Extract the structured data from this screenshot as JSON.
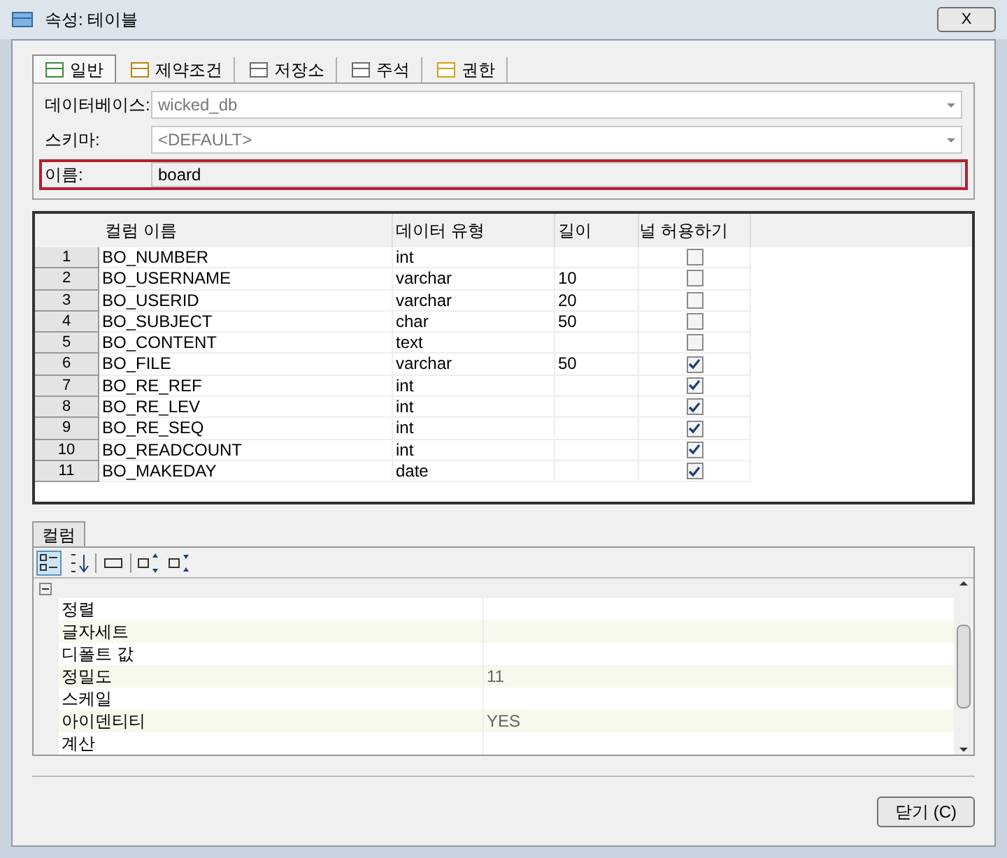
{
  "window": {
    "title": "속성: 테이블",
    "close": "X"
  },
  "tabs": [
    {
      "label": "일반",
      "selected": true
    },
    {
      "label": "제약조건",
      "selected": false
    },
    {
      "label": "저장소",
      "selected": false
    },
    {
      "label": "주석",
      "selected": false
    },
    {
      "label": "권한",
      "selected": false
    }
  ],
  "fields": [
    {
      "label": "데이터베이스:",
      "value": "wicked_db",
      "kind": "dropdown",
      "highlighted": false
    },
    {
      "label": "스키마:",
      "value": "<DEFAULT>",
      "kind": "dropdown",
      "highlighted": false
    },
    {
      "label": "이름:",
      "value": "board",
      "kind": "text",
      "highlighted": true
    }
  ],
  "table": {
    "columns": [
      "컬럼 이름",
      "데이터 유형",
      "길이",
      "널 허용하기"
    ],
    "rows": [
      {
        "index": "1",
        "name": "BO_NUMBER",
        "type": "int",
        "checked": false
      },
      {
        "index": "2",
        "name": "BO_USERNAME",
        "type": "varchar",
        "length": "10",
        "checked": false
      },
      {
        "index": "3",
        "name": "BO_USERID",
        "type": "varchar",
        "length": "20",
        "checked": false
      },
      {
        "index": "4",
        "name": "BO_SUBJECT",
        "type": "char",
        "length": "50",
        "checked": false
      },
      {
        "index": "5",
        "name": "BO_CONTENT",
        "type": "text",
        "checked": false
      },
      {
        "index": "6",
        "name": "BO_FILE",
        "type": "varchar",
        "length": "50",
        "checked": true
      },
      {
        "index": "7",
        "name": "BO_RE_REF",
        "type": "int",
        "checked": true
      },
      {
        "index": "8",
        "name": "BO_RE_LEV",
        "type": "int",
        "checked": true
      },
      {
        "index": "9",
        "name": "BO_RE_SEQ",
        "type": "int",
        "checked": true
      },
      {
        "index": "10",
        "name": "BO_READCOUNT",
        "type": "int",
        "checked": true
      },
      {
        "index": "11",
        "name": "BO_MAKEDAY",
        "type": "date",
        "checked": true
      }
    ]
  },
  "bottom_tab": {
    "label": "컬럼"
  },
  "properties": {
    "expanded": true,
    "rows": [
      {
        "name": "정렬"
      },
      {
        "name": "글자세트"
      },
      {
        "name": "디폴트 값"
      },
      {
        "name": "정밀도",
        "value": "11"
      },
      {
        "name": "스케일"
      },
      {
        "name": "아이덴티티",
        "value": "YES"
      },
      {
        "name": "계산"
      }
    ]
  },
  "buttons": [
    "닫기 (C)"
  ]
}
